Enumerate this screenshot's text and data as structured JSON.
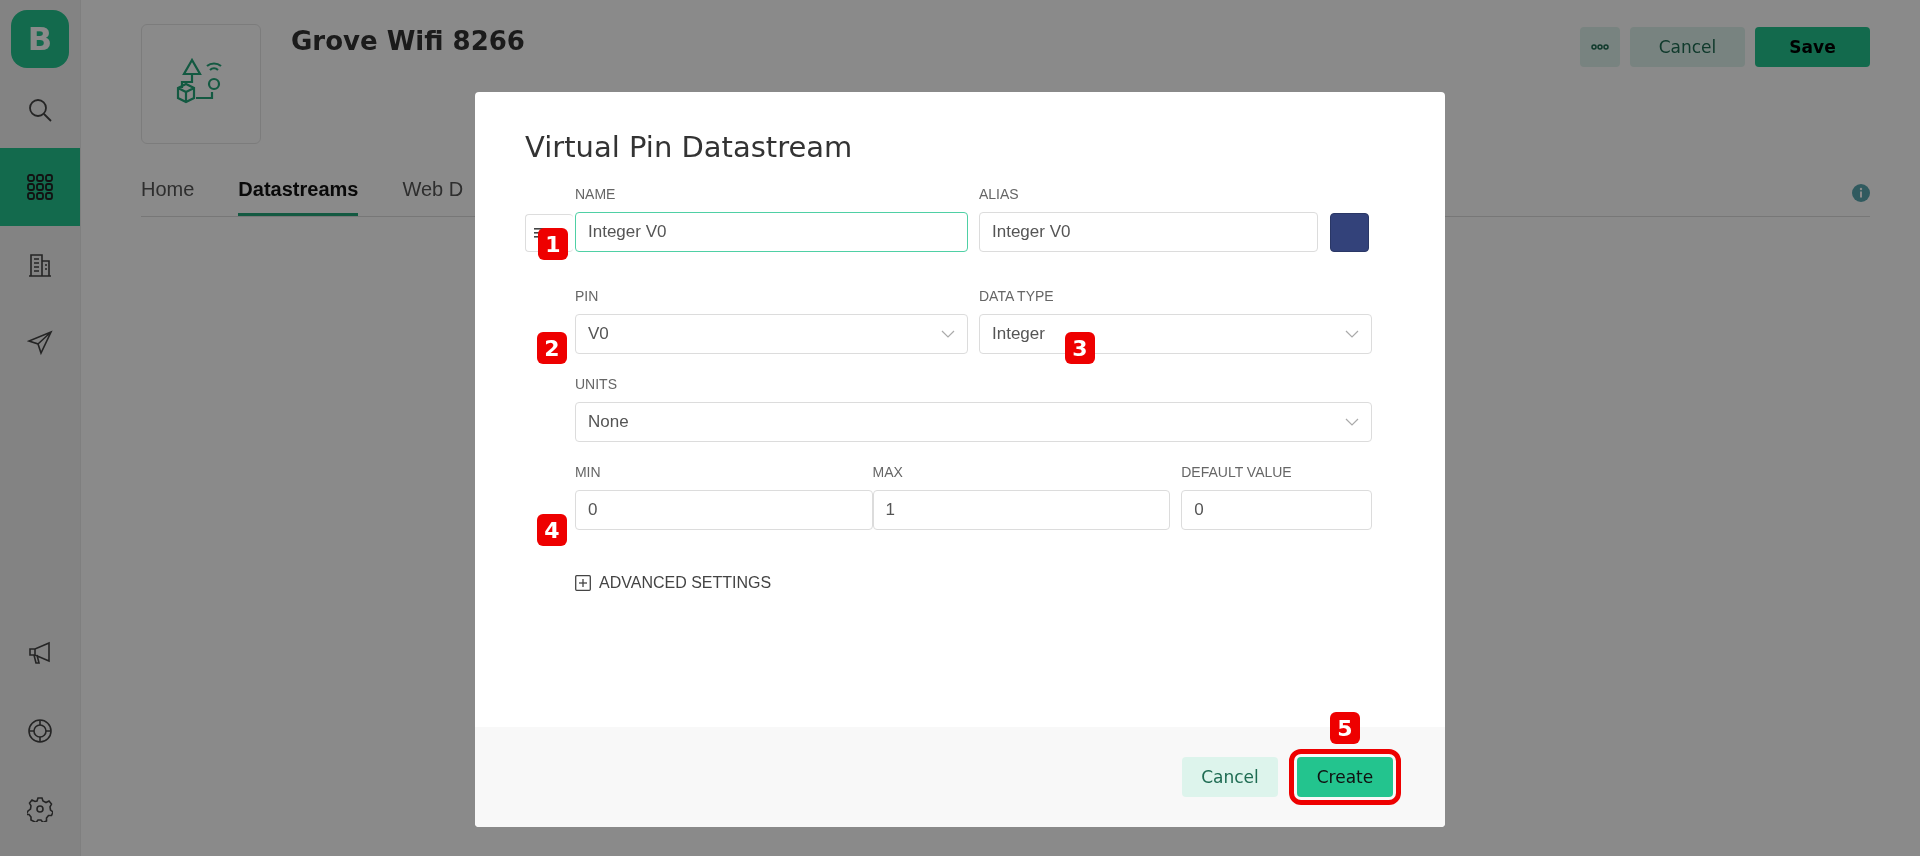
{
  "sidebar": {
    "logo": "B",
    "items": [
      {
        "selected": false
      },
      {
        "selected": true
      },
      {
        "selected": false
      },
      {
        "selected": false
      }
    ],
    "bottom_items": [
      {
        "selected": false
      },
      {
        "selected": false
      },
      {
        "selected": false
      }
    ]
  },
  "header": {
    "title": "Grove Wifi 8266",
    "buttons": [
      {
        "kind": "more"
      },
      {
        "kind": "secondary",
        "label": "Cancel"
      },
      {
        "kind": "primary",
        "label": "Save"
      }
    ]
  },
  "tabs": [
    {
      "label": "Home",
      "selected": false
    },
    {
      "label": "Datastreams",
      "selected": true
    },
    {
      "label": "Web D",
      "selected": false
    }
  ],
  "dialog": {
    "title": "Virtual Pin Datastream",
    "name": {
      "label": "NAME",
      "value": "Integer V0",
      "focused": true
    },
    "alias": {
      "label": "ALIAS",
      "value": "Integer V0",
      "focused": false
    },
    "color": "#33427a",
    "pin": {
      "label": "PIN",
      "value": "V0"
    },
    "data_type": {
      "label": "DATA TYPE",
      "value": "Integer"
    },
    "units": {
      "label": "UNITS",
      "value": "None"
    },
    "min": {
      "label": "MIN",
      "value": "0"
    },
    "max": {
      "label": "MAX",
      "value": "1"
    },
    "default_value": {
      "label": "DEFAULT VALUE",
      "value": "0"
    },
    "advanced_settings": {
      "label": "ADVANCED SETTINGS",
      "expanded": false
    },
    "buttons": [
      {
        "kind": "secondary",
        "label": "Cancel",
        "highlighted": false
      },
      {
        "kind": "primary",
        "label": "Create",
        "highlighted": true
      }
    ]
  },
  "annotations": [
    "1",
    "2",
    "3",
    "4",
    "5"
  ]
}
